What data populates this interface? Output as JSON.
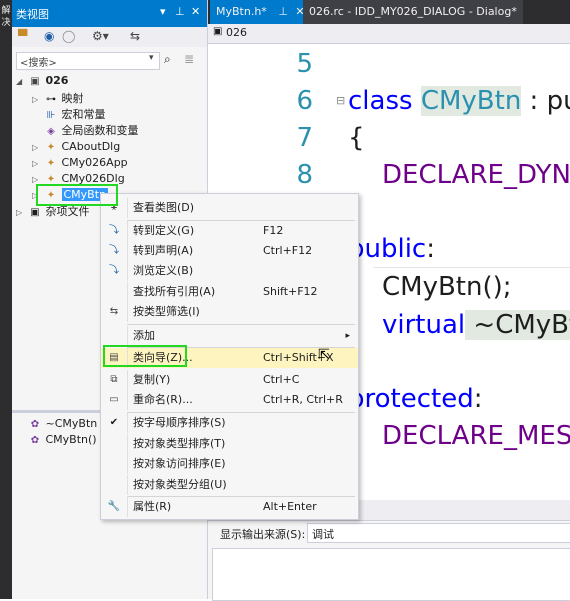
{
  "side_strip": {
    "labels": [
      "解",
      "决"
    ]
  },
  "class_view": {
    "title": "类视图",
    "title_icons": [
      "▾",
      "⊥",
      "✕"
    ],
    "search_placeholder": "<搜索>",
    "tree": [
      {
        "label": "026",
        "expanded": true,
        "icon": "project-icon"
      },
      {
        "label": "映射",
        "icon": "map-icon"
      },
      {
        "label": "宏和常量",
        "icon": "macro-icon"
      },
      {
        "label": "全局函数和变量",
        "icon": "globals-icon"
      },
      {
        "label": "CAboutDlg",
        "icon": "class-icon"
      },
      {
        "label": "CMy026App",
        "icon": "class-icon"
      },
      {
        "label": "CMy026Dlg",
        "icon": "class-icon"
      },
      {
        "label": "CMyBtn",
        "icon": "class-icon",
        "selected": true
      },
      {
        "label": "杂项文件",
        "icon": "misc-files-icon"
      }
    ],
    "members": [
      {
        "label": "~CMyBtn"
      },
      {
        "label": "CMyBtn()"
      }
    ]
  },
  "editor": {
    "tabs": [
      {
        "label": "MyBtn.h*",
        "pin": "⊥",
        "close": "✕"
      },
      {
        "label": "026.rc - IDD_MY026_DIALOG - Dialog*"
      }
    ],
    "nav_label": "026",
    "lines": [
      {
        "num": "5",
        "text": ""
      },
      {
        "num": "6",
        "kw": "class",
        "cls": "CMyBtn",
        "rest": " : pu"
      },
      {
        "num": "7",
        "text": "{"
      },
      {
        "num": "8",
        "mac": "DECLARE_DYN"
      },
      {
        "kw": "public",
        "rest": ":"
      },
      {
        "text": "CMyBtn();"
      },
      {
        "kw": "virtual",
        "rest": " ~CMyBt"
      },
      {
        "kw": "protected",
        "rest": ":"
      },
      {
        "mac": "DECLARE_MES"
      }
    ]
  },
  "output": {
    "source_label": "显示输出来源(S):",
    "source_value": "调试"
  },
  "context_menu": {
    "items": [
      {
        "label": "查看类图(D)",
        "shortcut": "",
        "icon": "class-diagram-icon"
      },
      {
        "label": "转到定义(G)",
        "shortcut": "F12",
        "icon": "go-to-definition-icon"
      },
      {
        "label": "转到声明(A)",
        "shortcut": "Ctrl+F12",
        "icon": "go-to-declaration-icon"
      },
      {
        "label": "浏览定义(B)",
        "shortcut": "",
        "icon": "browse-definition-icon"
      },
      {
        "label": "查找所有引用(A)",
        "shortcut": "Shift+F12",
        "icon": ""
      },
      {
        "label": "按类型筛选(I)",
        "shortcut": "",
        "icon": "filter-type-icon"
      },
      {
        "label": "添加",
        "shortcut": "",
        "icon": "",
        "submenu": "▸"
      },
      {
        "label": "类向导(Z)...",
        "shortcut": "Ctrl+Shift+X",
        "icon": "class-wizard-icon",
        "hover": true
      },
      {
        "label": "复制(Y)",
        "shortcut": "Ctrl+C",
        "icon": "copy-icon"
      },
      {
        "label": "重命名(R)...",
        "shortcut": "Ctrl+R, Ctrl+R",
        "icon": "rename-icon"
      },
      {
        "label": "按字母顺序排序(S)",
        "shortcut": "",
        "icon": "checkmark-icon"
      },
      {
        "label": "按对象类型排序(T)",
        "shortcut": "",
        "icon": ""
      },
      {
        "label": "按对象访问排序(E)",
        "shortcut": "",
        "icon": ""
      },
      {
        "label": "按对象类型分组(U)",
        "shortcut": "",
        "icon": ""
      },
      {
        "label": "属性(R)",
        "shortcut": "Alt+Enter",
        "icon": "wrench-icon"
      }
    ]
  },
  "colors": {
    "accent": "#007acc",
    "highlight_box": "#22d822",
    "menu_hover": "#fdf4bf"
  }
}
